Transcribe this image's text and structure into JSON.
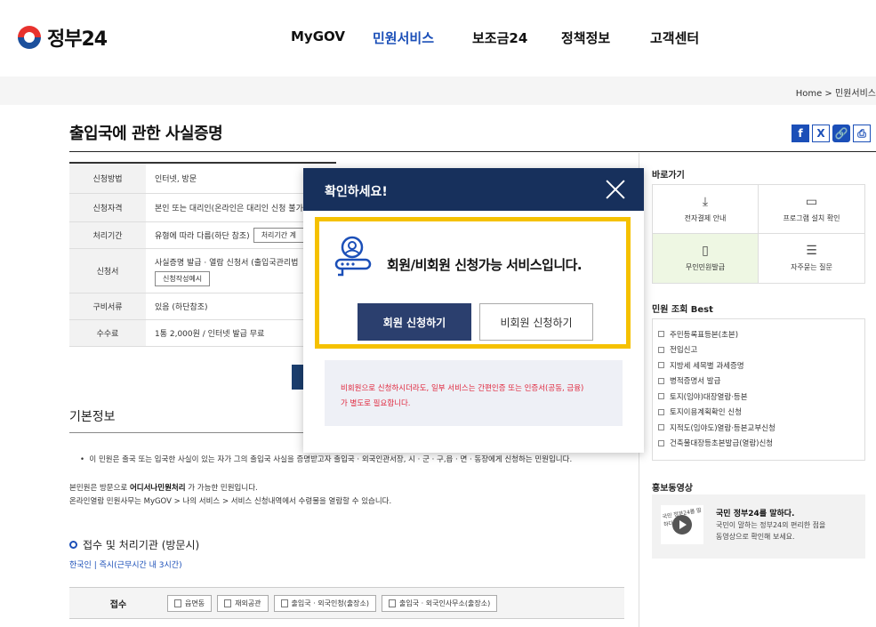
{
  "header": {
    "logo_text": "정부24",
    "nav": [
      "MyGOV",
      "민원서비스",
      "보조금24",
      "정책정보",
      "고객센터"
    ]
  },
  "breadcrumb": "Home  >  민원서비스",
  "page_title": "출입국에 관한 사실증명",
  "share": {
    "facebook": "f",
    "x": "X",
    "link": "🔗",
    "print": "⎙"
  },
  "info_table": {
    "rows": [
      {
        "label": "신청방법",
        "value": "인터넷, 방문"
      },
      {
        "label": "신청자격",
        "value": "본인 또는 대리인(온라인은 대리인 신청 불가"
      },
      {
        "label": "처리기간",
        "value": "유형에 따라 다름(하단 참조)",
        "button": "처리기간 계"
      },
      {
        "label": "신청서",
        "value": "사실증명 발급 · 열람 신청서 (출입국관리법",
        "button": "신청작성예시"
      },
      {
        "label": "구비서류",
        "value": "있음 (하단참조)"
      },
      {
        "label": "수수료",
        "value": "1통 2,000원 / 인터넷 발급 무료"
      }
    ]
  },
  "basic_info": {
    "title": "기본정보",
    "bullet": "이 민원은 출국 또는 입국한 사실이 있는 자가 그의 출입국 사실을 증명받고자 출입국 · 외국인관서장, 시 · 군 · 구,읍 · 면 · 동장에게 신청하는 민원입니다.",
    "para_line1_pre": "본민원은 방문으로 ",
    "para_line1_bold": "어디서나민원처리",
    "para_line1_post": " 가 가능한 민원입니다.",
    "para_line2": "온라인열람 민원사무는 MyGOV > 나의 서비스 > 서비스 신청내역에서 수령물을 열람할 수 있습니다.",
    "sub_title": "접수 및 처리기관 (방문시)",
    "sub_text": "한국인 | 즉시(근무시간 내 3시간)",
    "reception_label": "접수",
    "reception_chips": [
      "읍면동",
      "재외공관",
      "출입국 · 외국인청(출장소)",
      "출입국 · 외국인사무소(출장소)"
    ]
  },
  "aside": {
    "quick_title": "바로가기",
    "quick_links": [
      {
        "label": "전자결제 안내",
        "icon": "download-icon"
      },
      {
        "label": "프로그램 설치 확인",
        "icon": "monitor-icon"
      },
      {
        "label": "무인민원발급",
        "icon": "kiosk-icon"
      },
      {
        "label": "자주묻는 질문",
        "icon": "faq-icon"
      }
    ],
    "best_title": "민원 조회 Best",
    "best_items": [
      "주민등록표등본(초본)",
      "전입신고",
      "지방세 세목별 과세증명",
      "병적증명서 발급",
      "토지(임야)대장열람·등본",
      "토지이용계획확인 신청",
      "지적도(임야도)열람·등본교부신청",
      "건축물대장등초본발급(열람)신청"
    ],
    "video_title": "홍보동영상",
    "video_heading": "국민 정부24를 말하다.",
    "video_desc_line1": "국민이 말하는 정부24의 편리한 점을",
    "video_desc_line2": "동영상으로 확인해 보세요.",
    "video_thumb_text": "국민 정부24를 말하다"
  },
  "modal": {
    "title": "확인하세요!",
    "message": "회원/비회원 신청가능 서비스입니다.",
    "member_button": "회원 신청하기",
    "guest_button": "비회원 신청하기",
    "warning_line1": "비회원으로 신청하시더라도, 일부 서비스는 간편인증 또는 인증서(공동, 금융)",
    "warning_line2": "가 별도로 필요합니다."
  },
  "colors": {
    "brand_blue": "#1b4fb8",
    "modal_header": "#17305c",
    "highlight_border": "#f5c100",
    "warning_red": "#e0283e"
  }
}
